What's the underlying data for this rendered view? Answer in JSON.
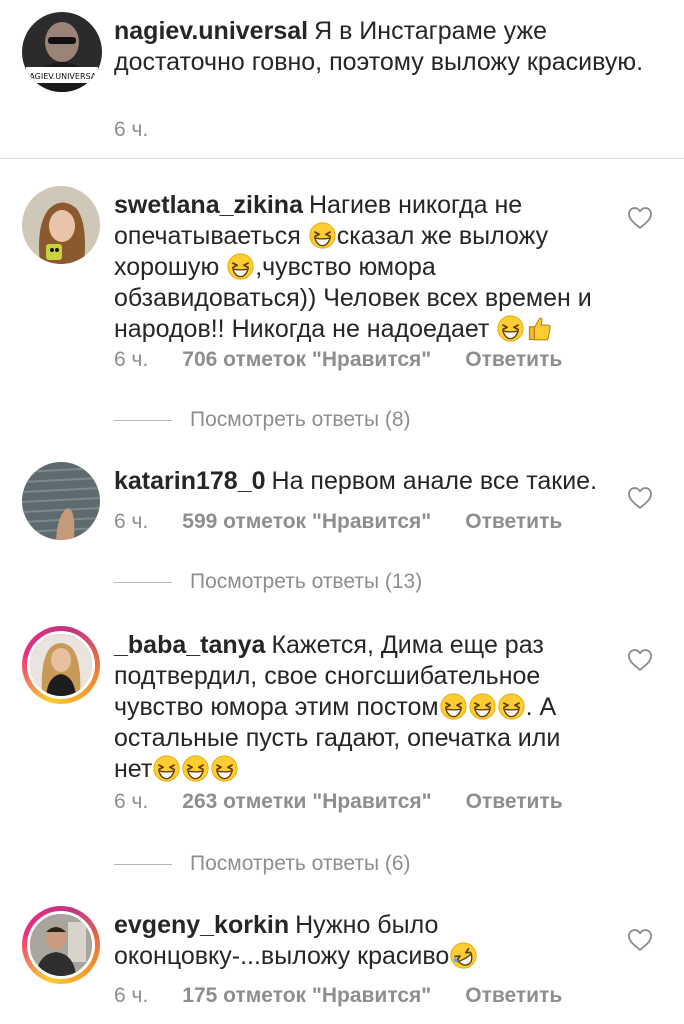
{
  "caption": {
    "username": "nagiev.universal",
    "text": "Я в Инстаграме уже достаточно говно, поэтому выложу красивую.",
    "time": "6 ч.",
    "avatar_label": "NAGIEV.UNIVERSAL"
  },
  "comments": [
    {
      "username": "swetlana_zikina",
      "parts": [
        "Нагиев никогда не опечатываеться ",
        "сказал же выложу хорошую ",
        ",чувство юмора обзавидоваться)) Человек всех времен и народов!! Никогда не надоедает "
      ],
      "time": "6 ч.",
      "likes": "706 отметок \"Нравится\"",
      "reply": "Ответить",
      "view_replies": "Посмотреть ответы (8)"
    },
    {
      "username": "katarin178_0",
      "text": "На первом анале все такие.",
      "time": "6 ч.",
      "likes": "599 отметок \"Нравится\"",
      "reply": "Ответить",
      "view_replies": "Посмотреть ответы (13)"
    },
    {
      "username": "_baba_tanya",
      "parts": [
        "Кажется, Дима еще раз подтвердил, свое сногсшибательное чувство юмора этим постом",
        ". А остальные пусть гадают, опечатка или нет"
      ],
      "time": "6 ч.",
      "likes": "263 отметки \"Нравится\"",
      "reply": "Ответить",
      "view_replies": "Посмотреть ответы (6)"
    },
    {
      "username": "evgeny_korkin",
      "text": "Нужно было оконцовку-...выложу красиво",
      "time": "6 ч.",
      "likes": "175 отметок \"Нравится\"",
      "reply": "Ответить"
    }
  ],
  "icons": {
    "like": "heart-outline-icon",
    "emoji_smile": "grinning-squinting-face-emoji",
    "emoji_thumb": "thumbs-up-emoji",
    "emoji_rofl": "rolling-on-floor-laughing-emoji"
  },
  "colors": {
    "text": "#262626",
    "secondary": "#8e8e8e",
    "divider": "#dbdbdb",
    "emoji_yellow": "#ffcc33"
  }
}
